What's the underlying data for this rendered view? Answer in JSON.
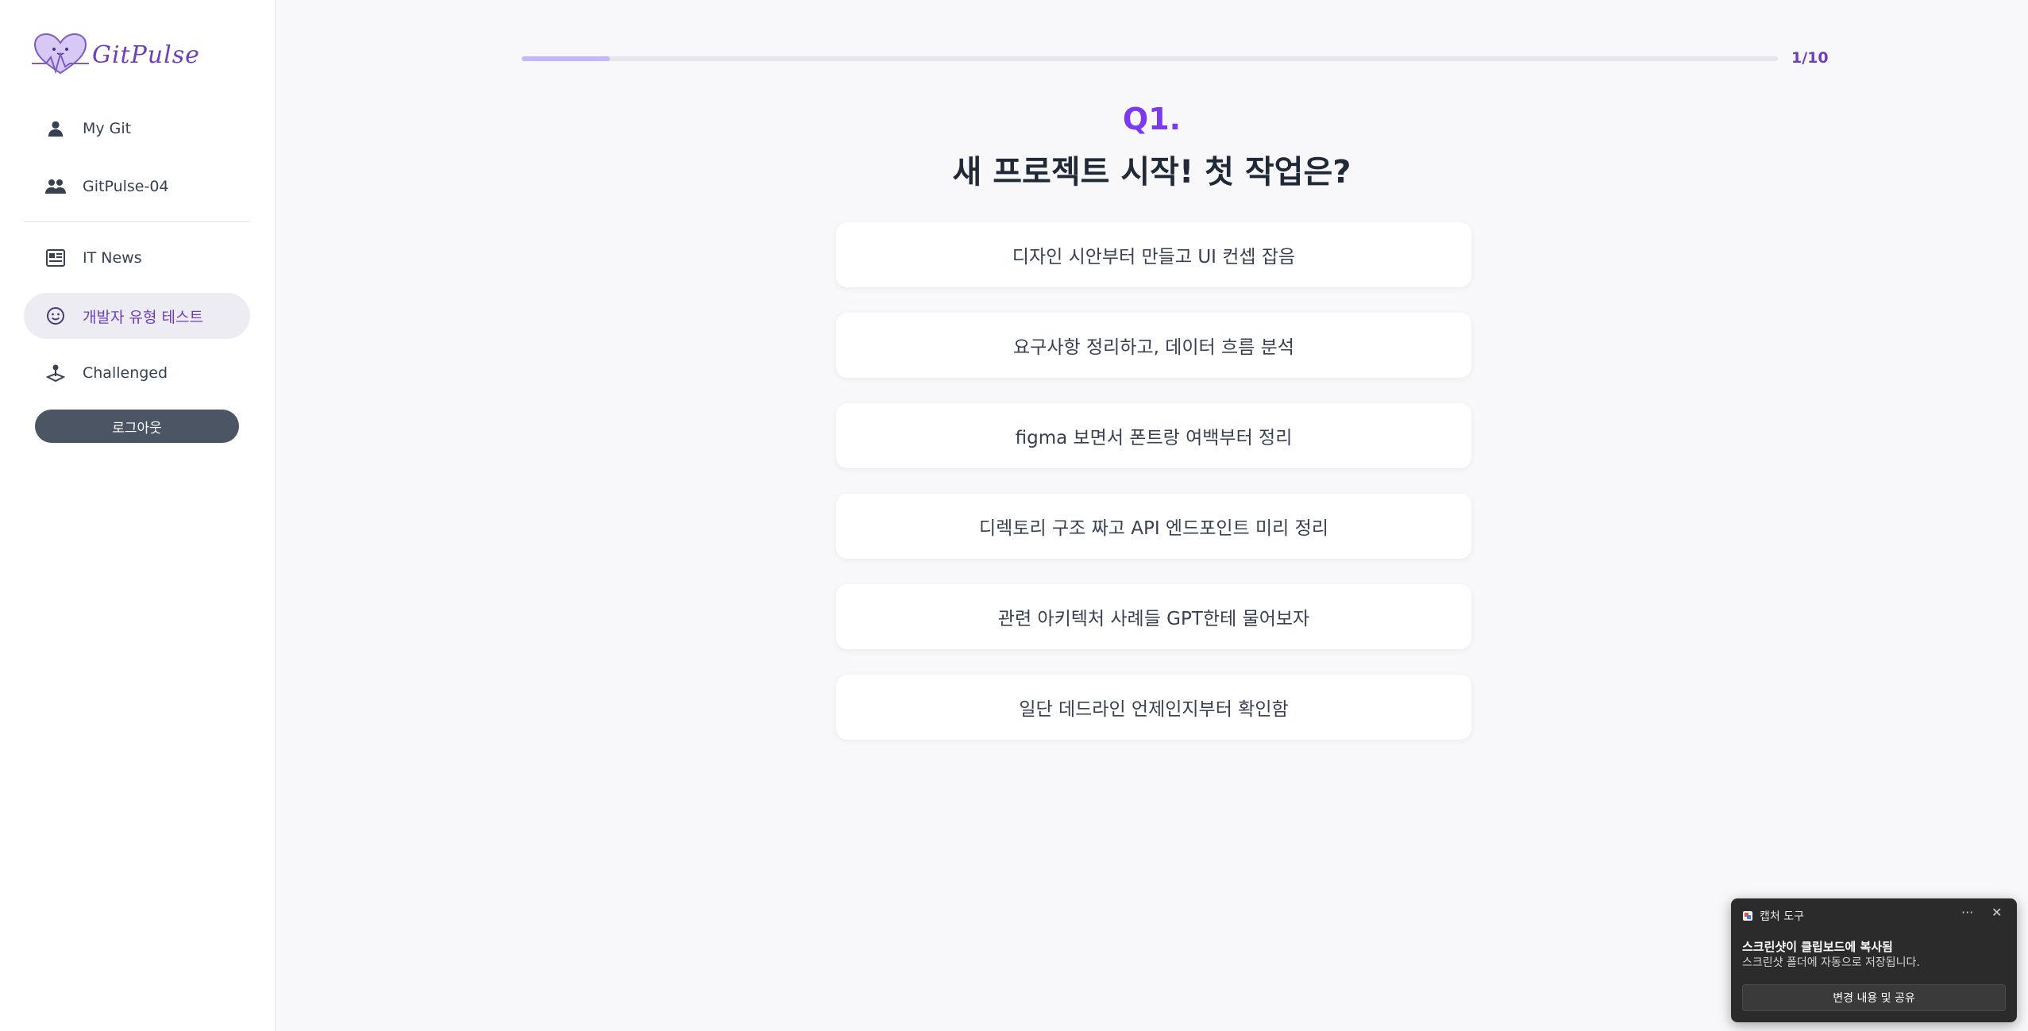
{
  "sidebar": {
    "logo_text": "GitPulse",
    "items": [
      {
        "label": "My Git",
        "icon": "person-icon"
      },
      {
        "label": "GitPulse-04",
        "icon": "people-icon"
      },
      {
        "label": "IT News",
        "icon": "newspaper-icon"
      },
      {
        "label": "개발자 유형 테스트",
        "icon": "smiley-icon",
        "active": true
      },
      {
        "label": "Challenged",
        "icon": "joystick-icon"
      }
    ],
    "logout_label": "로그아웃"
  },
  "quiz": {
    "progress_text": "1/10",
    "progress_fraction": 0.07,
    "question_number": "Q1.",
    "question_text": "새 프로젝트 시작! 첫 작업은?",
    "options": [
      "디자인 시안부터 만들고 UI 컨셉 잡음",
      "요구사항 정리하고, 데이터 흐름 분석",
      "figma 보면서 폰트랑 여백부터 정리",
      "디렉토리 구조 짜고 API 엔드포인트 미리 정리",
      "관련 아키텍처 사례들 GPT한테 물어보자",
      "일단 데드라인 언제인지부터 확인함"
    ]
  },
  "toast": {
    "app_name": "캡처 도구",
    "title": "스크린샷이 클립보드에 복사됨",
    "body": "스크린샷 폴더에 자동으로 저장됩니다.",
    "button_label": "변경 내용 및 공유",
    "more_glyph": "···",
    "close_glyph": "✕"
  },
  "colors": {
    "accent": "#7c3aed",
    "progress_fill": "#c4b5fd",
    "logout_bg": "#4b5563",
    "active_nav_bg": "#ececf2"
  }
}
